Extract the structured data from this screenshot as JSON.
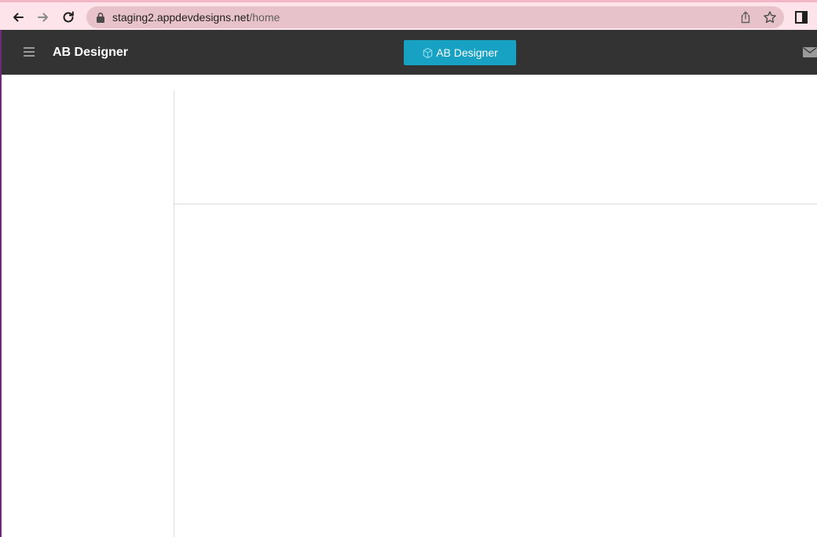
{
  "browser": {
    "url_host": "staging2.appdevdesigns.net",
    "url_path": "/home",
    "icons": [
      "back-arrow-icon",
      "forward-arrow-icon",
      "reload-icon",
      "lock-icon",
      "share-icon",
      "star-icon",
      "side-panel-icon"
    ]
  },
  "header": {
    "title": "AB Designer",
    "designer_button_label": "AB Designer",
    "background_color": "#333333",
    "accent_color": "#17a2c4",
    "icons": [
      "hamburger-menu-icon",
      "cube-icon",
      "mail-icon"
    ]
  }
}
